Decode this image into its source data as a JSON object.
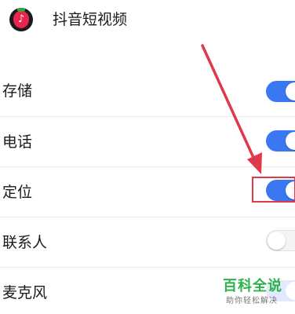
{
  "header": {
    "app_icon": "douyin-app-icon",
    "app_name": "抖音短视频"
  },
  "permissions": [
    {
      "label": "存储",
      "enabled": true
    },
    {
      "label": "电话",
      "enabled": true
    },
    {
      "label": "定位",
      "enabled": true,
      "highlighted": true
    },
    {
      "label": "联系人",
      "enabled": false
    },
    {
      "label": "麦克风",
      "enabled": true
    }
  ],
  "annotation": {
    "arrow_color": "#e03a4a",
    "highlight_color": "#e03a4a"
  },
  "watermark": {
    "title": "百科全说",
    "subtitle": "助你轻松解决"
  },
  "colors": {
    "toggle_on": "#3a78f2",
    "toggle_off": "#f4f4f4",
    "watermark_green": "#2bb24c"
  }
}
